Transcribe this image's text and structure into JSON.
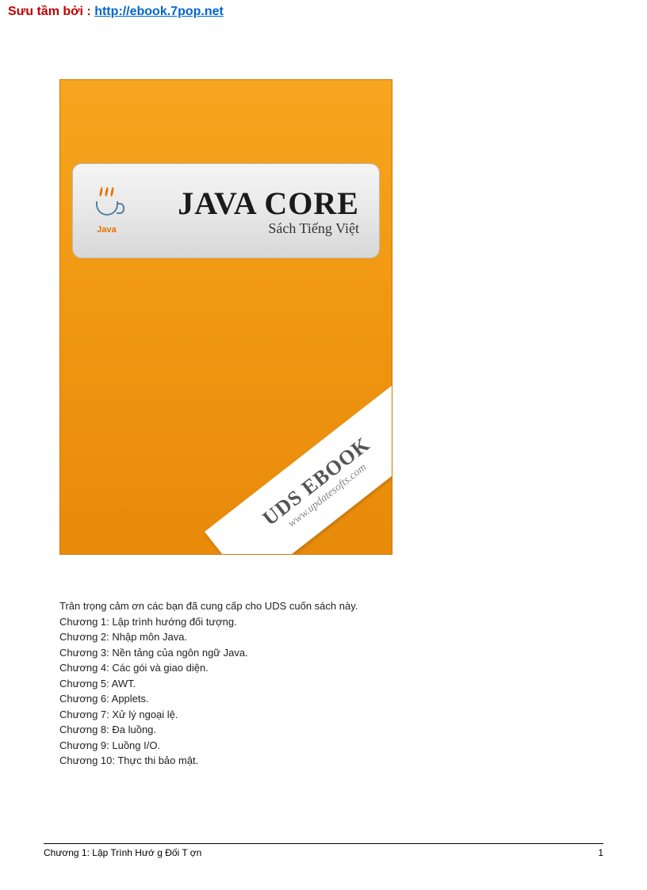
{
  "header": {
    "attribution_label": "Sưu tầm bởi : ",
    "attribution_link": "http://ebook.7pop.net"
  },
  "cover": {
    "logo_text": "Java",
    "main_title": "JAVA CORE",
    "subtitle": "Sách Tiếng Việt",
    "ribbon_title": "UDS EBOOK",
    "ribbon_url": "www.updatesofts.com"
  },
  "content": {
    "intro": "Trân trọng cảm ơn các bạn đã cung cấp cho UDS cuốn sách này.",
    "chapters": [
      "Chương 1: Lập trình hướng đối tượng.",
      "Chương 2: Nhập môn Java.",
      "Chương 3: Nền tảng của ngôn ngữ Java.",
      "Chương 4: Các gói và giao diện.",
      "Chương 5: AWT.",
      "Chương 6: Applets.",
      "Chương 7: Xử lý ngoại lệ.",
      "Chương 8: Đa luồng.",
      "Chương 9: Luồng I/O.",
      "Chương 10: Thực thi bảo mật."
    ]
  },
  "footer": {
    "chapter_label": "Chương 1: Lập Trình Hướ g Đối T   ợn",
    "page_number": "1"
  }
}
